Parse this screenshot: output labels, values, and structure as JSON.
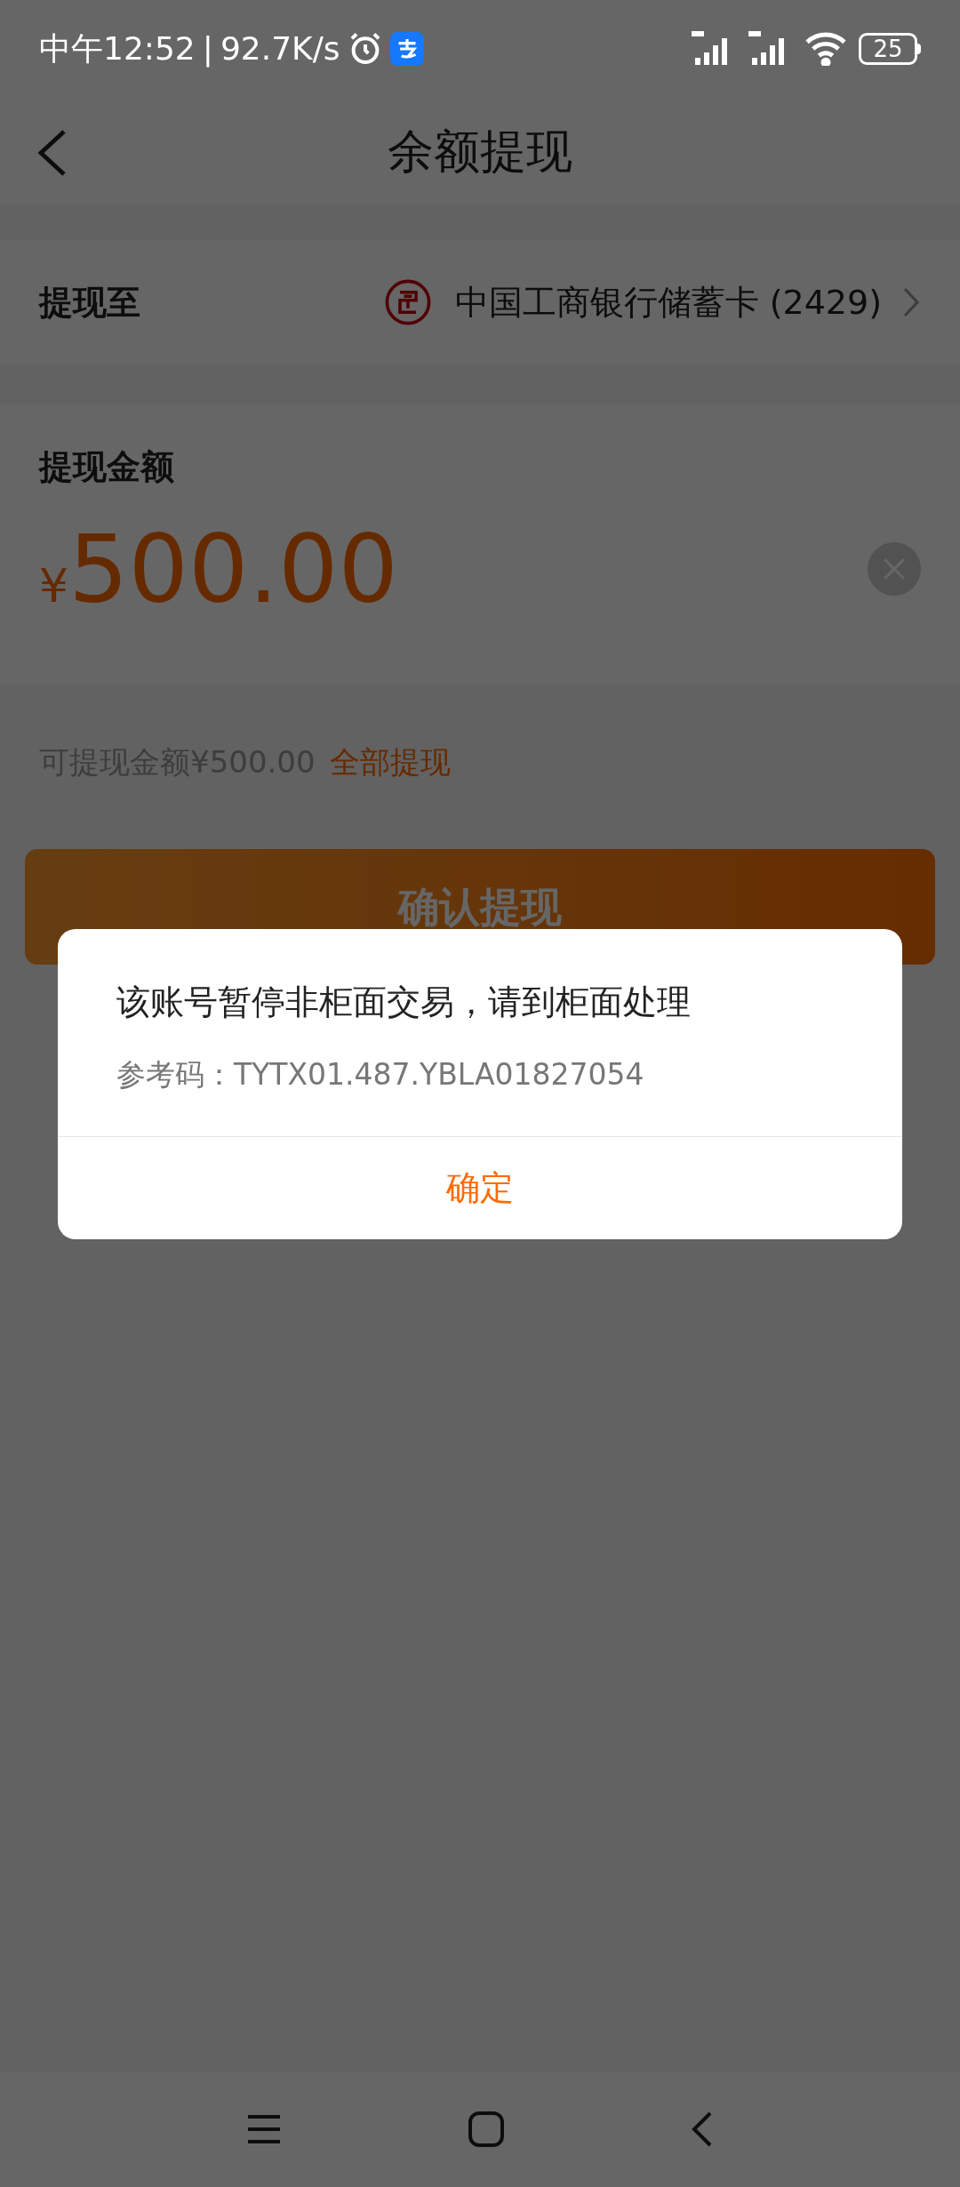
{
  "status_bar": {
    "time": "中午12:52",
    "separator": "|",
    "speed": "92.7K/s",
    "battery": "25"
  },
  "header": {
    "title": "余额提现"
  },
  "withdraw_to": {
    "label": "提现至",
    "bank": "中国工商银行储蓄卡 (2429)"
  },
  "amount": {
    "label": "提现金额",
    "currency": "¥",
    "value": "500.00"
  },
  "available": {
    "text": "可提现金额¥500.00",
    "link": "全部提现"
  },
  "confirm_button": "确认提现",
  "dialog": {
    "message": "该账号暂停非柜面交易，请到柜面处理",
    "reference": "参考码：TYTX01.487.YBLA01827054",
    "ok_button": "确定"
  }
}
